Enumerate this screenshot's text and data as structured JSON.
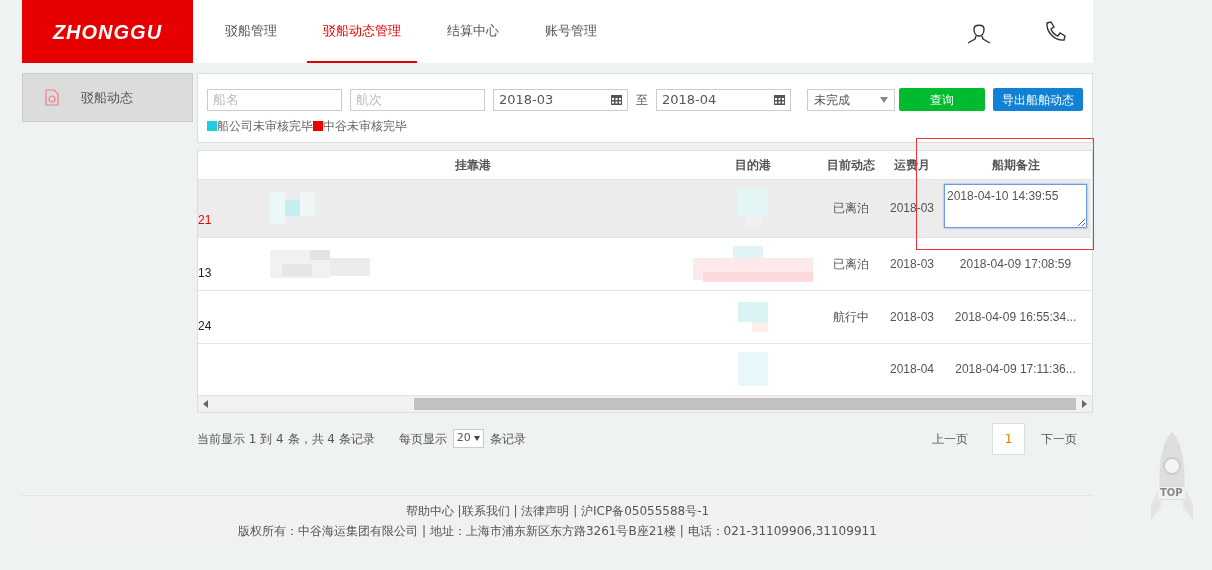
{
  "logo": {
    "text": "ZHONGGU"
  },
  "nav": [
    {
      "label": "驳船管理",
      "selected": false
    },
    {
      "label": "驳船动态管理",
      "selected": true
    },
    {
      "label": "结算中心",
      "selected": false
    },
    {
      "label": "账号管理",
      "selected": false
    }
  ],
  "sidebar": {
    "items": [
      {
        "label": "驳船动态",
        "selected": true
      }
    ]
  },
  "filters": {
    "ship_name": {
      "placeholder": "船名"
    },
    "voyage": {
      "placeholder": "航次"
    },
    "date_from": "2018-03",
    "to_label": "至",
    "date_to": "2018-04",
    "status": "未完成",
    "search_button": "查询",
    "export_button": "导出船舶动态"
  },
  "legend": [
    {
      "label": "船公司未审核完毕",
      "color": "#1ecde0"
    },
    {
      "label": "中谷未审核完毕",
      "color": "#ee0000"
    }
  ],
  "table": {
    "columns": [
      "挂靠港",
      "目的港",
      "目前动态",
      "运费月",
      "船期备注"
    ],
    "rows": [
      {
        "column_1": "21",
        "color": "#ee0000",
        "selected": true,
        "status": "已离泊",
        "month": "2018-03",
        "remark": "2018-04-10 14:39:55",
        "kind": "textarea"
      },
      {
        "column_1": "13",
        "color": "#222222",
        "selected": false,
        "status": "已离泊",
        "month": "2018-03",
        "remark": "2018-04-09 17:08:59",
        "kind": "text"
      },
      {
        "column_1": "24",
        "color": "#222222",
        "selected": false,
        "status": "航行中",
        "month": "2018-03",
        "remark": "2018-04-09 16:55:34...",
        "kind": "text"
      },
      {
        "selected": false,
        "month": "2018-04",
        "remark": "2018-04-09 17:11:36...",
        "kind": "text"
      }
    ]
  },
  "pagination": {
    "summary": "当前显示 1 到 4 条，共 4 条记录",
    "per_page_label": "每页显示",
    "per_page": "20",
    "per_page_suffix": "条记录",
    "prev": "上一页",
    "pages": [
      {
        "label": "1",
        "selected": true
      }
    ],
    "next": "下一页"
  },
  "footer": {
    "links": "帮助中心 |联系我们 | 法律声明 | 沪ICP备05055588号-1",
    "copyright": "版权所有：中谷海运集团有限公司 | 地址：上海市浦东新区东方路3261号B座21楼 | 电话：021-31109906,31109911"
  },
  "back_to_top": "TOP"
}
